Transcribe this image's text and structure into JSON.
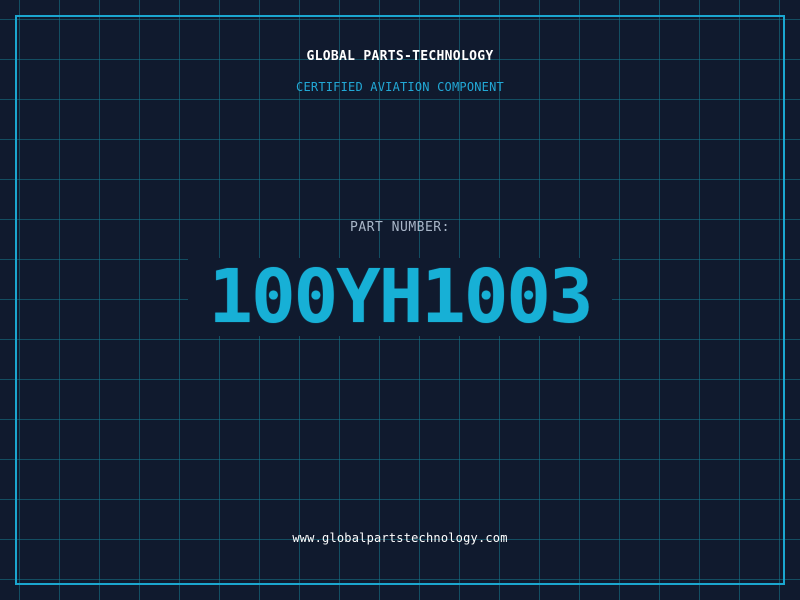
{
  "header": {
    "company": "GLOBAL PARTS-TECHNOLOGY",
    "subtitle": "CERTIFIED AVIATION COMPONENT"
  },
  "part": {
    "label": "PART NUMBER:",
    "number": "100YH1003"
  },
  "footer": {
    "website": "www.globalpartstechnology.com"
  },
  "colors": {
    "background": "#101a2e",
    "grid": "#16788c",
    "accent": "#1ba6cf",
    "part_number": "#17b0d6",
    "label": "#a9b6c8",
    "text": "#ffffff"
  }
}
